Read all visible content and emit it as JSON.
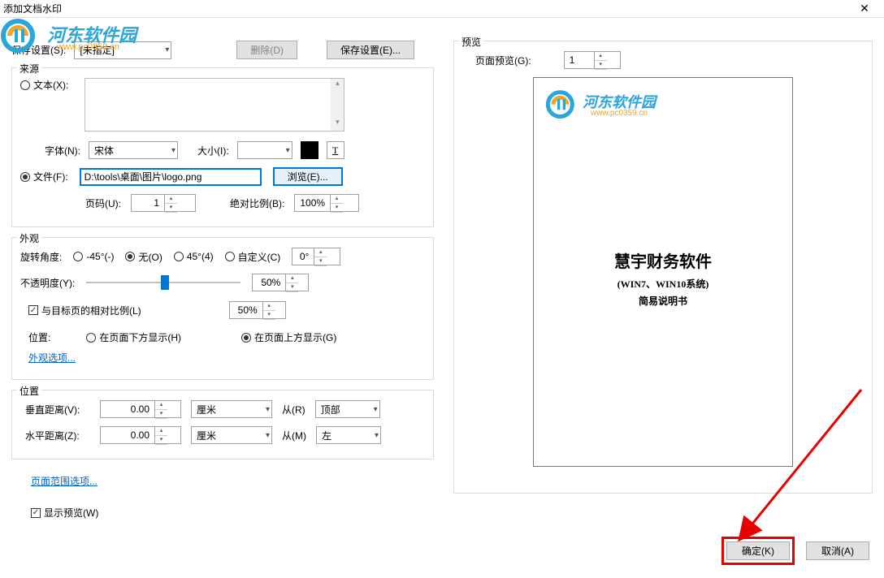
{
  "title": "添加文档水印",
  "watermark": {
    "text": "河东软件园",
    "url": "www.pc0359.cn"
  },
  "toprow": {
    "save_label": "保存设置(S):",
    "save_value": "[未指定]",
    "delete_btn": "删除(D)",
    "save_btn": "保存设置(E)..."
  },
  "source": {
    "legend": "来源",
    "text_radio": "文本(X):",
    "font_label": "字体(N):",
    "font_value": "宋体",
    "size_label": "大小(I):",
    "size_value": "",
    "file_radio": "文件(F):",
    "file_path": "D:\\tools\\桌面\\图片\\logo.png",
    "browse_btn": "浏览(E)...",
    "page_label": "页码(U):",
    "page_value": "1",
    "scale_label": "绝对比例(B):",
    "scale_value": "100%"
  },
  "appearance": {
    "legend": "外观",
    "rotate_label": "旋转角度:",
    "rot_neg45": "-45°(-)",
    "rot_none": "无(O)",
    "rot_45": "45°(4)",
    "rot_custom": "自定义(C)",
    "rot_value": "0°",
    "opacity_label": "不透明度(Y):",
    "opacity_value": "50%",
    "relscale_check": "与目标页的相对比例(L)",
    "relscale_value": "50%",
    "position_label": "位置:",
    "pos_below": "在页面下方显示(H)",
    "pos_above": "在页面上方显示(G)",
    "options_link": "外观选项..."
  },
  "position": {
    "legend": "位置",
    "vdist_label": "垂直距离(V):",
    "vdist_value": "0.00",
    "vunit": "厘米",
    "vfrom_label": "从(R)",
    "vfrom_value": "顶部",
    "hdist_label": "水平距离(Z):",
    "hdist_value": "0.00",
    "hunit": "厘米",
    "hfrom_label": "从(M)",
    "hfrom_value": "左"
  },
  "range_link": "页面范围选项...",
  "show_preview": "显示预览(W)",
  "preview": {
    "legend": "预览",
    "page_label": "页面预览(G):",
    "page_value": "1",
    "doc_title": "慧宇财务软件",
    "doc_sub": "(WIN7、WIN10系统)",
    "doc_sub2": "简易说明书"
  },
  "buttons": {
    "ok": "确定(K)",
    "cancel": "取消(A)"
  }
}
